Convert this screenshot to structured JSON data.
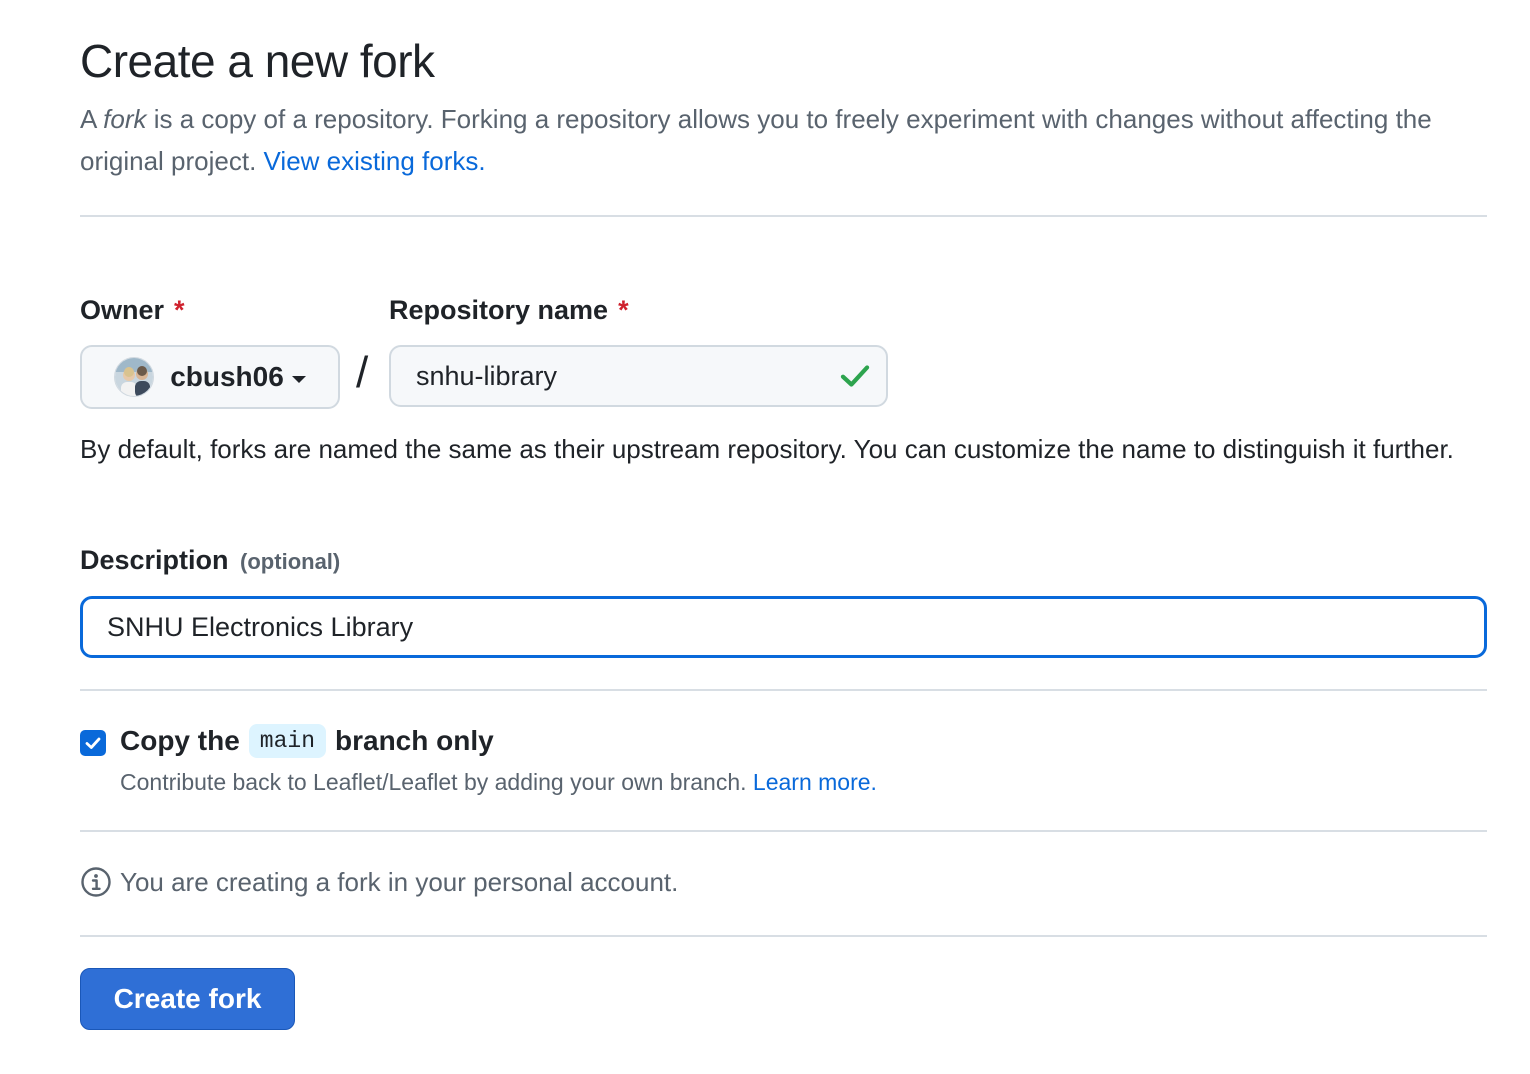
{
  "page": {
    "title": "Create a new fork",
    "intro_prefix": "A ",
    "intro_fork_word": "fork",
    "intro_text": " is a copy of a repository. Forking a repository allows you to freely experiment with changes without affecting the original project. ",
    "view_forks_link": "View existing forks."
  },
  "owner": {
    "label": "Owner",
    "required_mark": "*",
    "selected": "cbush06",
    "avatar_icon": "user-avatar"
  },
  "separator": "/",
  "repo_name": {
    "label": "Repository name",
    "required_mark": "*",
    "value": "snhu-library",
    "status_icon": "check-icon",
    "status_color": "#1a7f37"
  },
  "name_help": "By default, forks are named the same as their upstream repository. You can customize the name to distinguish it further.",
  "description": {
    "label": "Description",
    "optional_label": "(optional)",
    "value": "SNHU Electronics Library"
  },
  "copy_branch": {
    "checked": true,
    "label_prefix": "Copy the",
    "branch": "main",
    "label_suffix": "branch only",
    "help_text": "Contribute back to Leaflet/Leaflet by adding your own branch. ",
    "learn_more_link": "Learn more."
  },
  "notice": {
    "icon": "info-icon",
    "text": "You are creating a fork in your personal account."
  },
  "submit": {
    "label": "Create fork",
    "color": "#2f6fd6"
  },
  "colors": {
    "link": "#0969da",
    "required": "#cf222e",
    "focus_border": "#0969da"
  }
}
